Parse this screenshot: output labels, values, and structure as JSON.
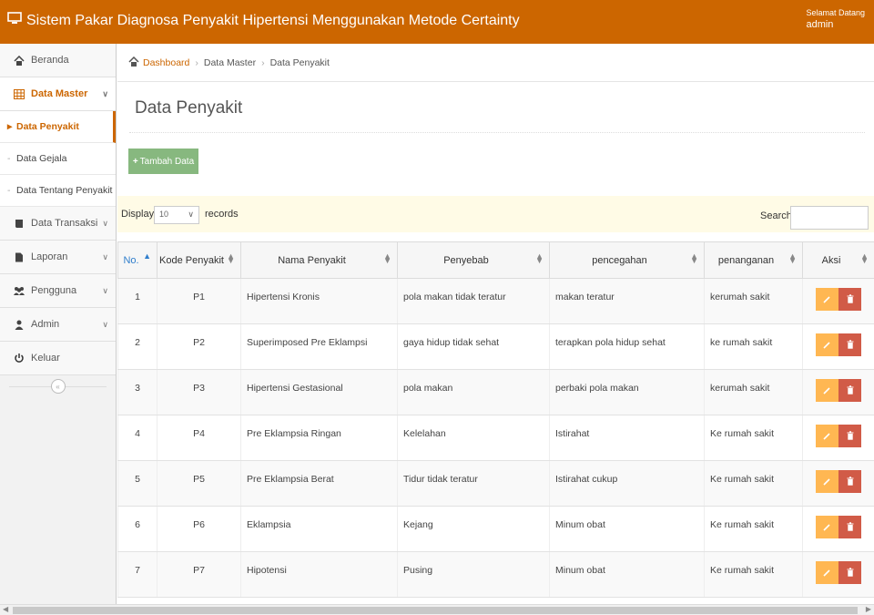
{
  "header": {
    "title": "Sistem Pakar Diagnosa Penyakit Hipertensi Menggunakan Metode Certainty",
    "welcome": "Selamat Datang",
    "user": "admin",
    "color": "#cc6600"
  },
  "sidebar": {
    "items": [
      {
        "label": "Beranda",
        "icon": "home-icon"
      },
      {
        "label": "Data Master",
        "icon": "table-grid-icon"
      },
      {
        "label": "Data Transaksi",
        "icon": "book-icon"
      },
      {
        "label": "Laporan",
        "icon": "file-icon"
      },
      {
        "label": "Pengguna",
        "icon": "users-icon"
      },
      {
        "label": "Admin",
        "icon": "user-icon"
      },
      {
        "label": "Keluar",
        "icon": "power-icon"
      }
    ],
    "subitems": [
      {
        "label": "Data Penyakit"
      },
      {
        "label": "Data Gejala"
      },
      {
        "label": "Data Tentang Penyakit"
      }
    ],
    "collapse": "«"
  },
  "breadcrumb": {
    "items": [
      "Dashboard",
      "Data Master",
      "Data Penyakit"
    ]
  },
  "main": {
    "page_title": "Data Penyakit",
    "add_button": "Tambah Data",
    "display_label": "Display",
    "page_size": "10",
    "records_label": "records",
    "search_label": "Search:",
    "search_value": ""
  },
  "table": {
    "headers": [
      "No.",
      "Kode Penyakit",
      "Nama Penyakit",
      "Penyebab",
      "pencegahan",
      "penanganan",
      "Aksi"
    ],
    "rows": [
      [
        "1",
        "P1",
        "Hipertensi Kronis",
        "pola makan tidak teratur",
        "makan teratur",
        "kerumah sakit"
      ],
      [
        "2",
        "P2",
        "Superimposed Pre Eklampsi",
        "gaya hidup tidak sehat",
        "terapkan pola hidup sehat",
        "ke rumah sakit"
      ],
      [
        "3",
        "P3",
        "Hipertensi Gestasional",
        "pola makan",
        "perbaki pola makan",
        "kerumah sakit"
      ],
      [
        "4",
        "P4",
        "Pre Eklampsia Ringan",
        "Kelelahan",
        "Istirahat",
        "Ke rumah sakit"
      ],
      [
        "5",
        "P5",
        "Pre Eklampsia Berat",
        "Tidur tidak teratur",
        "Istirahat cukup",
        "Ke rumah sakit"
      ],
      [
        "6",
        "P6",
        "Eklampsia",
        "Kejang",
        "Minum obat",
        "Ke rumah sakit"
      ],
      [
        "7",
        "P7",
        "Hipotensi",
        "Pusing",
        "Minum obat",
        "Ke rumah sakit"
      ]
    ]
  },
  "colors": {
    "accent": "#cc6600",
    "add_button": "#87b87f",
    "edit_button": "#ffb752",
    "delete_button": "#d15b47",
    "sort_active": "#307ecc"
  }
}
